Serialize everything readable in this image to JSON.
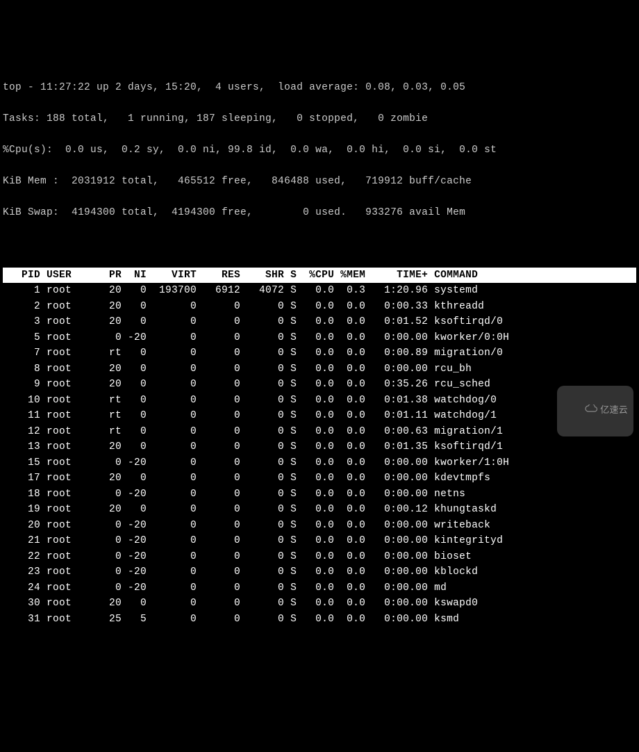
{
  "summary1": "top - 11:27:22 up 2 days, 15:20,  4 users,  load average: 0.08, 0.03, 0.05",
  "summary2": "Tasks: 188 total,   1 running, 187 sleeping,   0 stopped,   0 zombie",
  "summary3": "%Cpu(s):  0.0 us,  0.2 sy,  0.0 ni, 99.8 id,  0.0 wa,  0.0 hi,  0.0 si,  0.0 st",
  "summary4": "KiB Mem :  2031912 total,   465512 free,   846488 used,   719912 buff/cache",
  "summary5": "KiB Swap:  4194300 total,  4194300 free,        0 used.   933276 avail Mem",
  "columns": "   PID USER      PR  NI    VIRT    RES    SHR S  %CPU %MEM     TIME+ COMMAND          ",
  "rows": [
    {
      "pid": "1",
      "user": "root",
      "pr": "20",
      "ni": "0",
      "virt": "193700",
      "res": "6912",
      "shr": "4072",
      "s": "S",
      "cpu": "0.0",
      "mem": "0.3",
      "time": "1:20.96",
      "cmd": "systemd"
    },
    {
      "pid": "2",
      "user": "root",
      "pr": "20",
      "ni": "0",
      "virt": "0",
      "res": "0",
      "shr": "0",
      "s": "S",
      "cpu": "0.0",
      "mem": "0.0",
      "time": "0:00.33",
      "cmd": "kthreadd"
    },
    {
      "pid": "3",
      "user": "root",
      "pr": "20",
      "ni": "0",
      "virt": "0",
      "res": "0",
      "shr": "0",
      "s": "S",
      "cpu": "0.0",
      "mem": "0.0",
      "time": "0:01.52",
      "cmd": "ksoftirqd/0"
    },
    {
      "pid": "5",
      "user": "root",
      "pr": "0",
      "ni": "-20",
      "virt": "0",
      "res": "0",
      "shr": "0",
      "s": "S",
      "cpu": "0.0",
      "mem": "0.0",
      "time": "0:00.00",
      "cmd": "kworker/0:0H"
    },
    {
      "pid": "7",
      "user": "root",
      "pr": "rt",
      "ni": "0",
      "virt": "0",
      "res": "0",
      "shr": "0",
      "s": "S",
      "cpu": "0.0",
      "mem": "0.0",
      "time": "0:00.89",
      "cmd": "migration/0"
    },
    {
      "pid": "8",
      "user": "root",
      "pr": "20",
      "ni": "0",
      "virt": "0",
      "res": "0",
      "shr": "0",
      "s": "S",
      "cpu": "0.0",
      "mem": "0.0",
      "time": "0:00.00",
      "cmd": "rcu_bh"
    },
    {
      "pid": "9",
      "user": "root",
      "pr": "20",
      "ni": "0",
      "virt": "0",
      "res": "0",
      "shr": "0",
      "s": "S",
      "cpu": "0.0",
      "mem": "0.0",
      "time": "0:35.26",
      "cmd": "rcu_sched"
    },
    {
      "pid": "10",
      "user": "root",
      "pr": "rt",
      "ni": "0",
      "virt": "0",
      "res": "0",
      "shr": "0",
      "s": "S",
      "cpu": "0.0",
      "mem": "0.0",
      "time": "0:01.38",
      "cmd": "watchdog/0"
    },
    {
      "pid": "11",
      "user": "root",
      "pr": "rt",
      "ni": "0",
      "virt": "0",
      "res": "0",
      "shr": "0",
      "s": "S",
      "cpu": "0.0",
      "mem": "0.0",
      "time": "0:01.11",
      "cmd": "watchdog/1"
    },
    {
      "pid": "12",
      "user": "root",
      "pr": "rt",
      "ni": "0",
      "virt": "0",
      "res": "0",
      "shr": "0",
      "s": "S",
      "cpu": "0.0",
      "mem": "0.0",
      "time": "0:00.63",
      "cmd": "migration/1"
    },
    {
      "pid": "13",
      "user": "root",
      "pr": "20",
      "ni": "0",
      "virt": "0",
      "res": "0",
      "shr": "0",
      "s": "S",
      "cpu": "0.0",
      "mem": "0.0",
      "time": "0:01.35",
      "cmd": "ksoftirqd/1"
    },
    {
      "pid": "15",
      "user": "root",
      "pr": "0",
      "ni": "-20",
      "virt": "0",
      "res": "0",
      "shr": "0",
      "s": "S",
      "cpu": "0.0",
      "mem": "0.0",
      "time": "0:00.00",
      "cmd": "kworker/1:0H"
    },
    {
      "pid": "17",
      "user": "root",
      "pr": "20",
      "ni": "0",
      "virt": "0",
      "res": "0",
      "shr": "0",
      "s": "S",
      "cpu": "0.0",
      "mem": "0.0",
      "time": "0:00.00",
      "cmd": "kdevtmpfs"
    },
    {
      "pid": "18",
      "user": "root",
      "pr": "0",
      "ni": "-20",
      "virt": "0",
      "res": "0",
      "shr": "0",
      "s": "S",
      "cpu": "0.0",
      "mem": "0.0",
      "time": "0:00.00",
      "cmd": "netns"
    },
    {
      "pid": "19",
      "user": "root",
      "pr": "20",
      "ni": "0",
      "virt": "0",
      "res": "0",
      "shr": "0",
      "s": "S",
      "cpu": "0.0",
      "mem": "0.0",
      "time": "0:00.12",
      "cmd": "khungtaskd"
    },
    {
      "pid": "20",
      "user": "root",
      "pr": "0",
      "ni": "-20",
      "virt": "0",
      "res": "0",
      "shr": "0",
      "s": "S",
      "cpu": "0.0",
      "mem": "0.0",
      "time": "0:00.00",
      "cmd": "writeback"
    },
    {
      "pid": "21",
      "user": "root",
      "pr": "0",
      "ni": "-20",
      "virt": "0",
      "res": "0",
      "shr": "0",
      "s": "S",
      "cpu": "0.0",
      "mem": "0.0",
      "time": "0:00.00",
      "cmd": "kintegrityd"
    },
    {
      "pid": "22",
      "user": "root",
      "pr": "0",
      "ni": "-20",
      "virt": "0",
      "res": "0",
      "shr": "0",
      "s": "S",
      "cpu": "0.0",
      "mem": "0.0",
      "time": "0:00.00",
      "cmd": "bioset"
    },
    {
      "pid": "23",
      "user": "root",
      "pr": "0",
      "ni": "-20",
      "virt": "0",
      "res": "0",
      "shr": "0",
      "s": "S",
      "cpu": "0.0",
      "mem": "0.0",
      "time": "0:00.00",
      "cmd": "kblockd"
    },
    {
      "pid": "24",
      "user": "root",
      "pr": "0",
      "ni": "-20",
      "virt": "0",
      "res": "0",
      "shr": "0",
      "s": "S",
      "cpu": "0.0",
      "mem": "0.0",
      "time": "0:00.00",
      "cmd": "md"
    },
    {
      "pid": "30",
      "user": "root",
      "pr": "20",
      "ni": "0",
      "virt": "0",
      "res": "0",
      "shr": "0",
      "s": "S",
      "cpu": "0.0",
      "mem": "0.0",
      "time": "0:00.00",
      "cmd": "kswapd0"
    },
    {
      "pid": "31",
      "user": "root",
      "pr": "25",
      "ni": "5",
      "virt": "0",
      "res": "0",
      "shr": "0",
      "s": "S",
      "cpu": "0.0",
      "mem": "0.0",
      "time": "0:00.00",
      "cmd": "ksmd"
    }
  ],
  "watermark": "亿速云"
}
